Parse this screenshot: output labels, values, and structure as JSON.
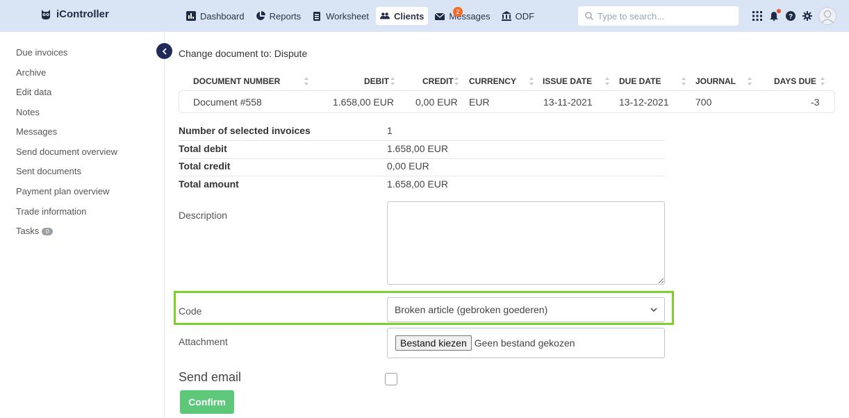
{
  "app": {
    "name": "iController"
  },
  "nav": [
    {
      "label": "Dashboard",
      "icon": "dashboard-icon"
    },
    {
      "label": "Reports",
      "icon": "pie-chart-icon"
    },
    {
      "label": "Worksheet",
      "icon": "clipboard-icon"
    },
    {
      "label": "Clients",
      "icon": "users-icon",
      "active": true
    },
    {
      "label": "Messages",
      "icon": "envelope-icon",
      "badge": "2"
    },
    {
      "label": "ODF",
      "icon": "bank-icon"
    }
  ],
  "search": {
    "placeholder": "Type to search..."
  },
  "sidebar": {
    "items": [
      {
        "label": "Due invoices"
      },
      {
        "label": "Archive"
      },
      {
        "label": "Edit data"
      },
      {
        "label": "Notes"
      },
      {
        "label": "Messages"
      },
      {
        "label": "Send document overview"
      },
      {
        "label": "Sent documents"
      },
      {
        "label": "Payment plan overview"
      },
      {
        "label": "Trade information"
      },
      {
        "label": "Tasks",
        "badge": "0"
      }
    ]
  },
  "main": {
    "heading": "Change document to: Dispute",
    "table": {
      "columns": [
        "DOCUMENT NUMBER",
        "DEBIT",
        "CREDIT",
        "CURRENCY",
        "ISSUE DATE",
        "DUE DATE",
        "JOURNAL",
        "DAYS DUE"
      ],
      "rows": [
        [
          "Document #558",
          "1.658,00 EUR",
          "0,00 EUR",
          "EUR",
          "13-11-2021",
          "13-12-2021",
          "700",
          "-3"
        ]
      ]
    },
    "summary": [
      {
        "label": "Number of selected invoices",
        "value": "1"
      },
      {
        "label": "Total debit",
        "value": "1.658,00 EUR"
      },
      {
        "label": "Total credit",
        "value": "0,00 EUR"
      },
      {
        "label": "Total amount",
        "value": "1.658,00 EUR"
      }
    ],
    "form": {
      "description_label": "Description",
      "description_value": "",
      "code_label": "Code",
      "code_value": "Broken article (gebroken goederen)",
      "attachment_label": "Attachment",
      "file_button": "Bestand kiezen",
      "file_status": "Geen bestand gekozen",
      "send_email_label": "Send email",
      "send_email_checked": false,
      "confirm_label": "Confirm"
    }
  },
  "colors": {
    "topbar": "#d9e4f5",
    "highlight": "#7fd02f",
    "confirm": "#5ec87a",
    "badge": "#f46b2a"
  }
}
